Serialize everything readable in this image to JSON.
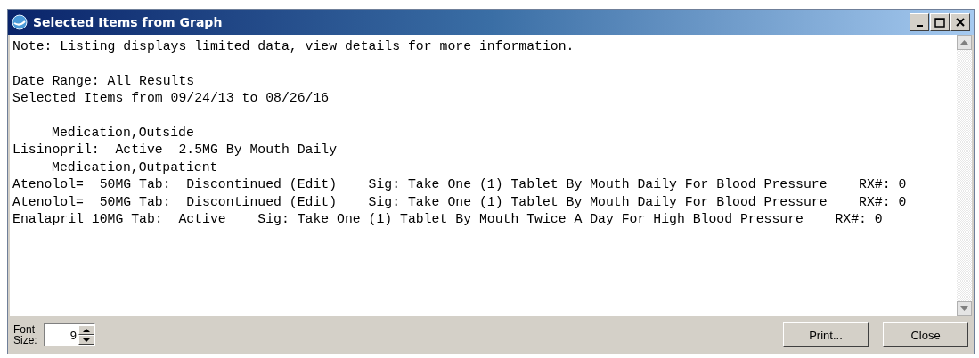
{
  "window": {
    "title": "Selected Items from Graph"
  },
  "paragraphs": [
    {
      "lines": [
        {
          "kind": "line",
          "text": "Note: Listing displays limited data, view details for more information."
        }
      ]
    },
    {
      "lines": [
        {
          "kind": "line",
          "text": "Date Range: All Results"
        },
        {
          "kind": "line",
          "text": "Selected Items from 09/24/13 to 08/26/16"
        }
      ]
    },
    {
      "lines": [
        {
          "kind": "heading",
          "text": "Medication,Outside"
        },
        {
          "kind": "line",
          "text": "Lisinopril:  Active  2.5MG By Mouth Daily"
        },
        {
          "kind": "heading",
          "text": "Medication,Outpatient"
        },
        {
          "kind": "line",
          "text": "Atenolol=  50MG Tab:  Discontinued (Edit)    Sig: Take One (1) Tablet By Mouth Daily For Blood Pressure    RX#: 0"
        },
        {
          "kind": "line",
          "text": "Atenolol=  50MG Tab:  Discontinued (Edit)    Sig: Take One (1) Tablet By Mouth Daily For Blood Pressure    RX#: 0"
        },
        {
          "kind": "line",
          "text": "Enalapril 10MG Tab:  Active    Sig: Take One (1) Tablet By Mouth Twice A Day For High Blood Pressure    RX#: 0"
        }
      ]
    }
  ],
  "font_size": {
    "label": "Font Size:",
    "value": "9"
  },
  "buttons": [
    "Print...",
    "Close"
  ]
}
